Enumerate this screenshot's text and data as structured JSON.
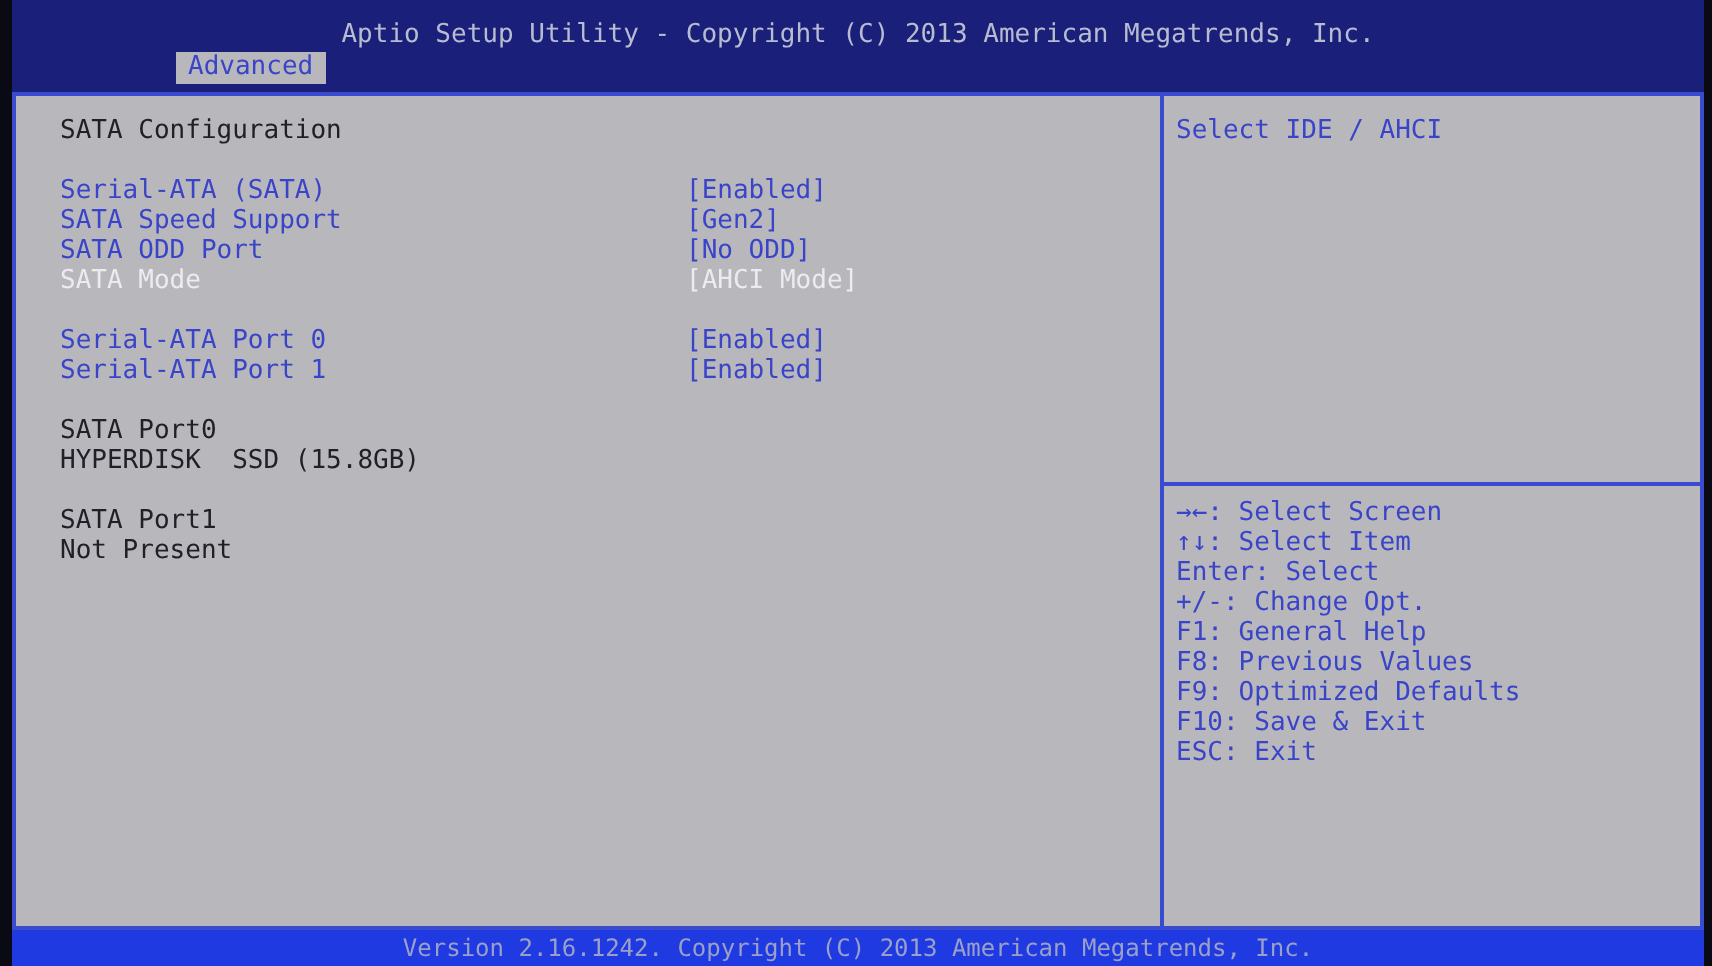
{
  "header": {
    "title": "Aptio Setup Utility - Copyright (C) 2013 American Megatrends, Inc."
  },
  "tabs": [
    {
      "label": "Advanced",
      "selected": true
    }
  ],
  "main": {
    "heading": "SATA Configuration",
    "groups": [
      [
        {
          "kind": "setting",
          "label": "Serial-ATA (SATA)",
          "value": "[Enabled]"
        },
        {
          "kind": "setting",
          "label": "SATA Speed Support",
          "value": "[Gen2]"
        },
        {
          "kind": "setting",
          "label": "SATA ODD Port",
          "value": "[No ODD]"
        },
        {
          "kind": "readonly",
          "label": "SATA Mode",
          "value": "[AHCI Mode]"
        }
      ],
      [
        {
          "kind": "setting",
          "label": "Serial-ATA Port 0",
          "value": "[Enabled]"
        },
        {
          "kind": "setting",
          "label": "Serial-ATA Port 1",
          "value": "[Enabled]"
        }
      ],
      [
        {
          "kind": "info",
          "label": "SATA Port0"
        },
        {
          "kind": "info",
          "label": "HYPERDISK  SSD (15.8GB)"
        }
      ],
      [
        {
          "kind": "info",
          "label": "SATA Port1"
        },
        {
          "kind": "info",
          "label": "Not Present"
        }
      ]
    ]
  },
  "help": {
    "text": "Select IDE / AHCI"
  },
  "keys": [
    "→←: Select Screen",
    "↑↓: Select Item",
    "Enter: Select",
    "+/-: Change Opt.",
    "F1: General Help",
    "F8: Previous Values",
    "F9: Optimized Defaults",
    "F10: Save & Exit",
    "ESC: Exit"
  ],
  "footer": {
    "text": "Version 2.16.1242. Copyright (C) 2013 American Megatrends, Inc."
  }
}
